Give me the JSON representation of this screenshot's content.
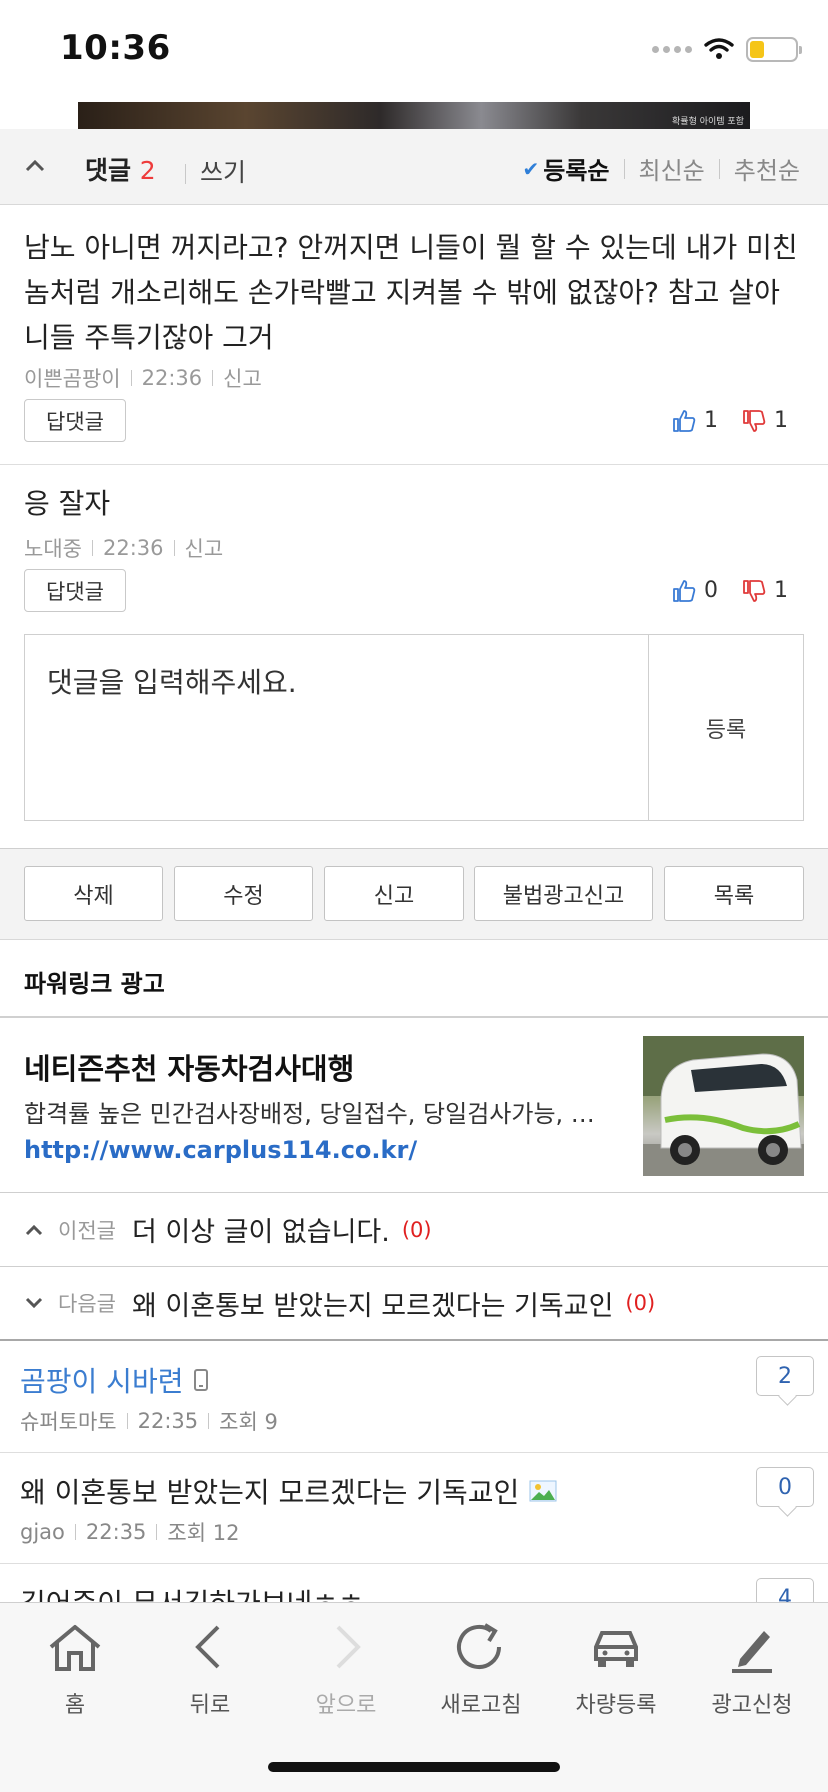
{
  "status_bar": {
    "time": "10:36"
  },
  "banner": {
    "caption": "확률형 아이템 포함"
  },
  "comments_header": {
    "label": "댓글",
    "count": "2",
    "write_label": "쓰기",
    "sort_options": [
      "등록순",
      "최신순",
      "추천순"
    ],
    "sort_selected": "등록순"
  },
  "comments": [
    {
      "text": "남노 아니면 꺼지라고? 안꺼지면 니들이 뭘 할 수 있는데 내가 미친놈처럼 개소리해도 손가락빨고 지켜볼 수 밖에 없잖아? 참고 살아 니들 주특기잖아 그거",
      "author": "이쁜곰팡이",
      "time": "22:36",
      "report": "신고",
      "reply_label": "답댓글",
      "likes": "1",
      "dislikes": "1"
    },
    {
      "text": "응 잘자",
      "author": "노대중",
      "time": "22:36",
      "report": "신고",
      "reply_label": "답댓글",
      "likes": "0",
      "dislikes": "1"
    }
  ],
  "comment_input": {
    "placeholder": "댓글을 입력해주세요.",
    "submit_label": "등록"
  },
  "actions": [
    "삭제",
    "수정",
    "신고",
    "불법광고신고",
    "목록"
  ],
  "ad": {
    "section_title": "파워링크 광고",
    "title": "네티즌추천 자동차검사대행",
    "description": "합격률 높은 민간검사장배정, 당일접수, 당일검사가능, 전문기사 차량픽업",
    "url": "http://www.carplus114.co.kr/"
  },
  "prev_post": {
    "label": "이전글",
    "title": "더 이상 글이 없습니다.",
    "count": "(0)"
  },
  "next_post": {
    "label": "다음글",
    "title": "왜 이혼통보 받았는지 모르겠다는 기독교인",
    "count": "(0)"
  },
  "posts": [
    {
      "title": "곰팡이 시바련",
      "author": "슈퍼토마토",
      "time": "22:35",
      "views": "조회 9",
      "comments": "2",
      "icon": "mobile-icon"
    },
    {
      "title": "왜 이혼통보 받았는지 모르겠다는 기독교인",
      "author": "gjao",
      "time": "22:35",
      "views": "조회 12",
      "comments": "0",
      "icon": "image-icon"
    },
    {
      "title": "김어준이 무서긴하가보네ㅎㅎ",
      "comments": "4"
    }
  ],
  "toolbar": {
    "items": [
      {
        "label": "홈",
        "icon": "home-icon"
      },
      {
        "label": "뒤로",
        "icon": "back-icon"
      },
      {
        "label": "앞으로",
        "icon": "forward-icon"
      },
      {
        "label": "새로고침",
        "icon": "refresh-icon"
      },
      {
        "label": "차량등록",
        "icon": "car-icon"
      },
      {
        "label": "광고신청",
        "icon": "pencil-icon"
      }
    ]
  },
  "colors": {
    "accent_red": "#ee3b3b",
    "link_blue": "#2a6cc6",
    "title_blue": "#3b7dd0",
    "check_blue": "#2f7fd8"
  }
}
